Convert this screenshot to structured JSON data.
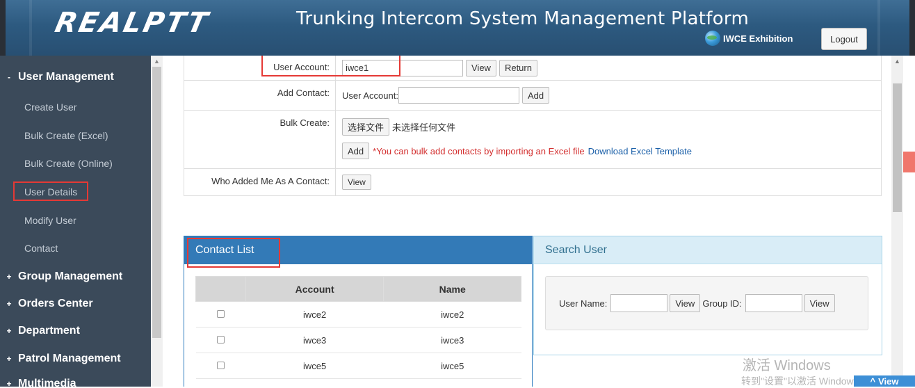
{
  "header": {
    "logo": "REALPTT",
    "title": "Trunking Intercom System Management Platform",
    "exhibition": "IWCE Exhibition",
    "logout": "Logout"
  },
  "sidebar": {
    "sections": [
      {
        "sign": "-",
        "label": "User Management"
      },
      {
        "sign": "+",
        "label": "Group Management"
      },
      {
        "sign": "+",
        "label": "Orders Center"
      },
      {
        "sign": "+",
        "label": "Department"
      },
      {
        "sign": "+",
        "label": "Patrol Management"
      },
      {
        "sign": "+",
        "label": "Multimedia"
      }
    ],
    "items": [
      "Create User",
      "Bulk Create (Excel)",
      "Bulk Create (Online)",
      "User Details",
      "Modify User",
      "Contact"
    ]
  },
  "form": {
    "user_account_label": "User Account:",
    "user_account_value": "iwce1",
    "view": "View",
    "return": "Return",
    "add_contact_label": "Add Contact:",
    "add_contact_prefix": "User Account:",
    "add": "Add",
    "bulk_create_label": "Bulk Create:",
    "choose_file": "选择文件",
    "no_file": "未选择任何文件",
    "bulk_note": "*You can bulk add contacts by importing an Excel file",
    "download_template": "Download Excel Template",
    "who_added_label": "Who Added Me As A Contact:"
  },
  "contact_list": {
    "title": "Contact List",
    "columns": [
      "",
      "Account",
      "Name"
    ],
    "rows": [
      {
        "account": "iwce2",
        "name": "iwce2"
      },
      {
        "account": "iwce3",
        "name": "iwce3"
      },
      {
        "account": "iwce5",
        "name": "iwce5"
      }
    ]
  },
  "search_user": {
    "title": "Search User",
    "user_name_label": "User Name:",
    "group_id_label": "Group ID:",
    "view": "View"
  },
  "watermark": {
    "line1": "激活 Windows",
    "line2": "转到\"设置\"以激活 Windows。"
  },
  "float_view": "View",
  "colors": {
    "sidebar_bg": "#3b4a5a",
    "primary": "#337ab7",
    "highlight": "#e53935"
  }
}
